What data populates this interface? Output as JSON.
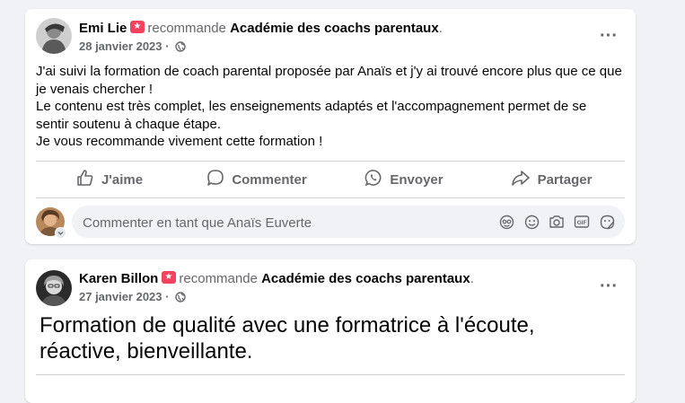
{
  "posts": [
    {
      "author": "Emi Lie",
      "verb": "recommande",
      "page": "Académie des coachs parentaux",
      "period": ".",
      "date": "28 janvier 2023",
      "sep": "·",
      "body": [
        "J'ai suivi la formation de coach parental proposée par Anaïs et j'y ai trouvé encore plus que ce que je venais chercher !",
        "Le contenu est très complet, les enseignements adaptés et l'accompagnement permet de se sentir soutenu à chaque étape.",
        "Je vous recommande vivement cette formation !"
      ],
      "actions": {
        "like": "J'aime",
        "comment": "Commenter",
        "send": "Envoyer",
        "share": "Partager"
      },
      "comment_placeholder": "Commenter en tant que Anaïs Euverte"
    },
    {
      "author": "Karen Billon",
      "verb": "recommande",
      "page": "Académie des coachs parentaux",
      "period": ".",
      "date": "27 janvier 2023",
      "sep": "·",
      "body": "Formation de qualité avec une formatrice à l'écoute, réactive, bienveillante."
    }
  ],
  "icons": {
    "recommend_badge": "recommend-badge-icon",
    "globe": "globe-icon",
    "more": "more-options-icon",
    "like": "thumbs-up-icon",
    "comment": "comment-bubble-icon",
    "send": "whatsapp-icon",
    "share": "share-arrow-icon",
    "avatar_emoji": "avatar-sticker-icon",
    "emoji": "emoji-icon",
    "camera": "camera-icon",
    "gif": "gif-icon",
    "sticker": "sticker-icon"
  },
  "colors": {
    "background": "#f0f2f5",
    "badge": "#f3425f",
    "muted": "#65676b"
  }
}
